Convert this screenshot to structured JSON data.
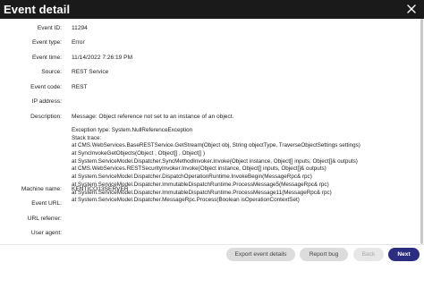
{
  "dialog": {
    "title": "Event detail",
    "close_icon": "close-icon"
  },
  "fields": [
    {
      "label": "Event ID:",
      "value": "11294"
    },
    {
      "label": "Event type:",
      "value": "Error"
    },
    {
      "label": "Event time:",
      "value": "11/14/2022 7:26:19 PM"
    },
    {
      "label": "Source:",
      "value": "REST Service"
    },
    {
      "label": "Event code:",
      "value": "REST"
    },
    {
      "label": "IP address:",
      "value": ""
    },
    {
      "label": "Description:",
      "value": "Message: Object reference not set to an instance of an object."
    }
  ],
  "stack": [
    "Exception type: System.NullReferenceException",
    "Stack trace:",
    "at CMS.WebServices.BaseRESTService.GetStream(Object obj, String objectType, TraverseObjectSettings settings)",
    "at SyncInvokeGetObjects(Object , Object[] , Object[] )",
    "at System.ServiceModel.Dispatcher.SyncMethodInvoker.Invoke(Object instance, Object[] inputs, Object[]& outputs)",
    "at CMS.WebServices.RESTSecurityInvoker.Invoke(Object instance, Object[] inputs, Object[]& outputs)",
    "at System.ServiceModel.Dispatcher.DispatchOperationRuntime.InvokeBegin(MessageRpc& rpc)",
    "at System.ServiceModel.Dispatcher.ImmutableDispatchRuntime.ProcessMessage5(MessageRpc& rpc)",
    "at System.ServiceModel.Dispatcher.ImmutableDispatchRuntime.ProcessMessage11(MessageRpc& rpc)",
    "at System.ServiceModel.Dispatcher.MessageRpc.Process(Boolean isOperationContextSet)"
  ],
  "fields_after": [
    {
      "label": "Machine name:",
      "value": "KENTICO13SERVER"
    },
    {
      "label": "Event URL:",
      "value": ""
    },
    {
      "label": "URL referrer:",
      "value": ""
    },
    {
      "label": "User agent:",
      "value": ""
    }
  ],
  "footer": {
    "export_label": "Export event details",
    "report_label": "Report bug",
    "back_label": "Back",
    "next_label": "Next"
  },
  "colors": {
    "header_bg": "#1a1a1a",
    "primary": "#2b2d80"
  }
}
